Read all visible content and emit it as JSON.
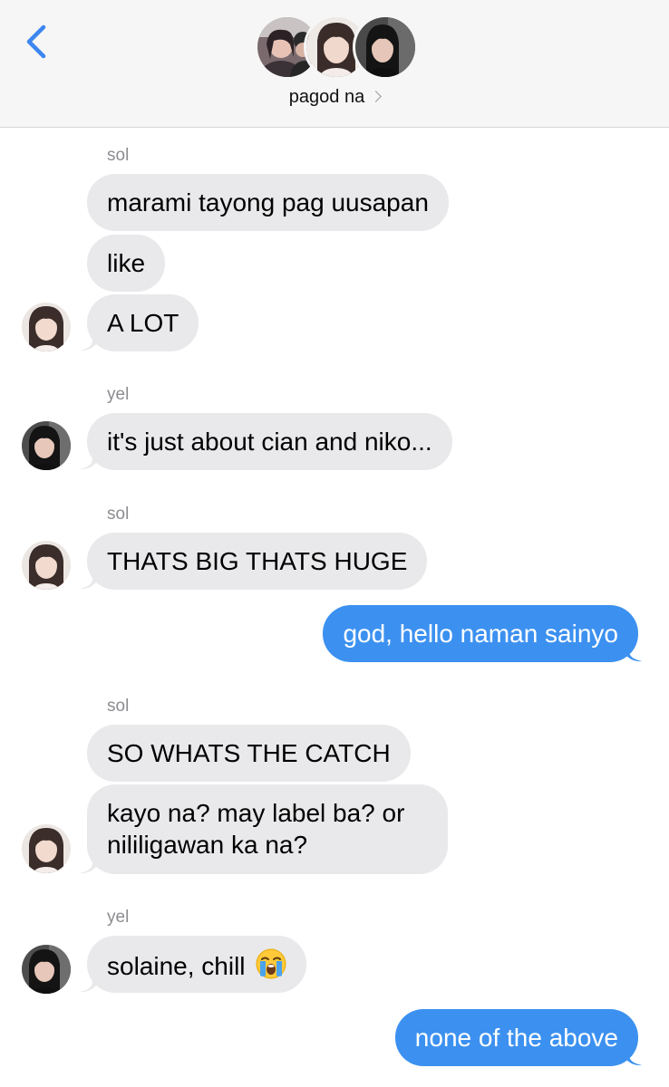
{
  "header": {
    "group_name": "pagod na",
    "back_icon": "chevron-left-icon",
    "name_chevron_icon": "chevron-right-icon"
  },
  "colors": {
    "accent": "#3c91f0",
    "incoming_bubble": "#e9e9eb",
    "sender_label": "#8c8c91",
    "header_bg": "#f6f6f6"
  },
  "messages": [
    {
      "sender": "sol",
      "text": "marami tayong pag uusapan"
    },
    {
      "text": "like"
    },
    {
      "text": "A LOT"
    },
    {
      "sender": "yel",
      "text": "it's just about cian and niko..."
    },
    {
      "sender": "sol",
      "text": "THATS BIG THATS HUGE"
    },
    {
      "outgoing": true,
      "text": "god, hello naman sainyo"
    },
    {
      "sender": "sol",
      "text": "SO WHATS THE CATCH"
    },
    {
      "text": "kayo na? may label ba? or nililigawan ka na?"
    },
    {
      "sender": "yel",
      "text": "solaine, chill",
      "emoji": "loudly-crying-face-icon"
    },
    {
      "outgoing": true,
      "text": "none of the above"
    }
  ]
}
